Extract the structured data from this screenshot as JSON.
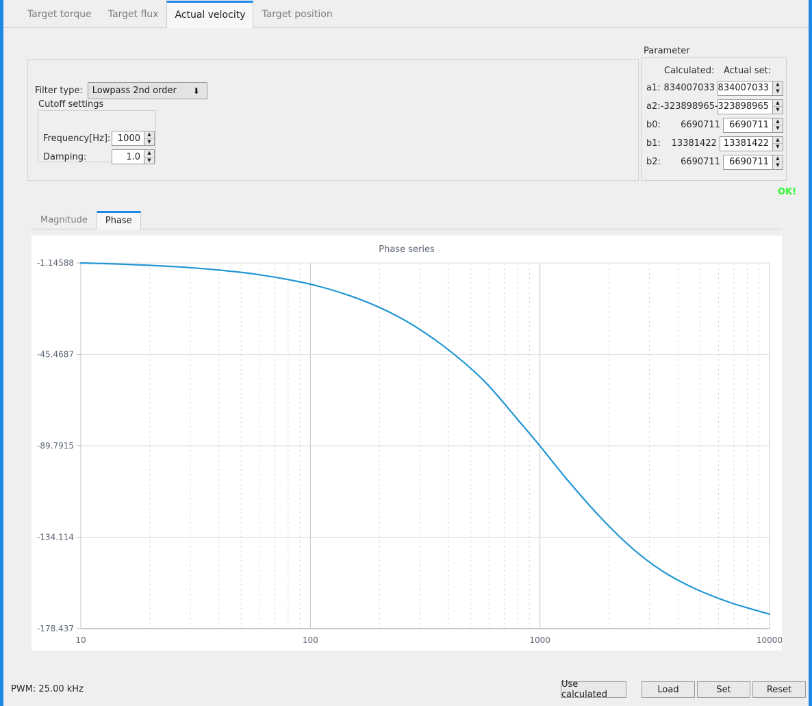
{
  "theme": {
    "accent": "#1e88e5",
    "curve_color": "#2196d4",
    "ok_color": "#2efa2e"
  },
  "top_tabs": [
    {
      "label": "Target torque",
      "active": false
    },
    {
      "label": "Target flux",
      "active": false
    },
    {
      "label": "Actual velocity",
      "active": true
    },
    {
      "label": "Target position",
      "active": false
    }
  ],
  "filter": {
    "type_label": "Filter type:",
    "type_value": "Lowpass 2nd order",
    "dropdown_icon": "chevron-down-icon",
    "group_title": "Cutoff settings",
    "frequency_label": "Frequency[Hz]:",
    "frequency_value": "1000",
    "damping_label": "Damping:",
    "damping_value": "1.0"
  },
  "parameter": {
    "title": "Parameter",
    "col_calculated": "Calculated:",
    "col_actual": "Actual set:",
    "rows": [
      {
        "name": "a1:",
        "calculated": "834007033",
        "actual": "834007033"
      },
      {
        "name": "a2:",
        "calculated": "-323898965",
        "actual": "-323898965"
      },
      {
        "name": "b0:",
        "calculated": "6690711",
        "actual": "6690711"
      },
      {
        "name": "b1:",
        "calculated": "13381422",
        "actual": "13381422"
      },
      {
        "name": "b2:",
        "calculated": "6690711",
        "actual": "6690711"
      }
    ],
    "status": "OK!"
  },
  "chart_tabs": [
    {
      "label": "Magnitude",
      "active": false
    },
    {
      "label": "Phase",
      "active": true
    }
  ],
  "chart_data": {
    "type": "line",
    "title": "Phase series",
    "xlabel": "",
    "ylabel": "",
    "xscale": "log",
    "xlim": [
      10,
      10000
    ],
    "ylim": [
      -178.437,
      -1.14588
    ],
    "grid": true,
    "legend": false,
    "xticks": [
      10,
      100,
      1000,
      10000
    ],
    "xtick_labels": [
      "10",
      "100",
      "1000",
      "10000"
    ],
    "yticks": [
      -1.14588,
      -45.4687,
      -89.7915,
      -134.114,
      -178.437
    ],
    "ytick_labels": [
      "-1.14588",
      "-45.4687",
      "-89.7915",
      "-134.114",
      "-178.437"
    ],
    "series": [
      {
        "name": "Phase",
        "color": "#2196d4",
        "x": [
          10,
          14,
          20,
          28,
          40,
          56,
          80,
          110,
          160,
          220,
          300,
          420,
          580,
          800,
          1000,
          1300,
          1800,
          2500,
          3400,
          4700,
          6500,
          8200,
          10000
        ],
        "y": [
          -1.15,
          -1.6,
          -2.3,
          -3.2,
          -4.6,
          -6.4,
          -9.2,
          -12.6,
          -18.3,
          -24.9,
          -33.4,
          -45.2,
          -59.1,
          -77.1,
          -89.9,
          -105.6,
          -123.5,
          -139.1,
          -150.4,
          -158.9,
          -165.2,
          -168.7,
          -171.4
        ]
      }
    ]
  },
  "bottom": {
    "pwm": "PWM: 25.00 kHz",
    "use_calculated": "Use calculated",
    "load": "Load",
    "set": "Set",
    "reset": "Reset"
  }
}
